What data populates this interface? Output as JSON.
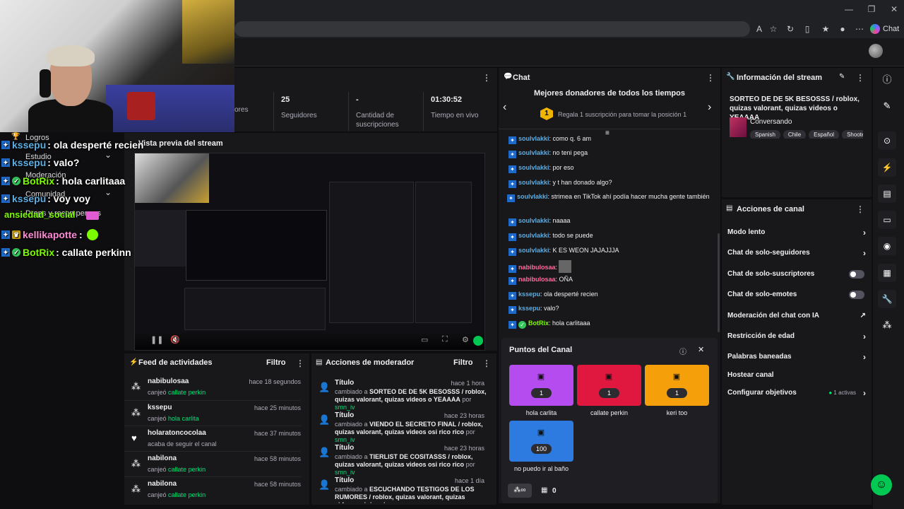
{
  "browser": {
    "chat_label": "Chat"
  },
  "overlay_chat": [
    {
      "user": "kssepu",
      "text": ": ola desperté recien",
      "badge": "blue"
    },
    {
      "user": "kssepu",
      "text": ": valo?",
      "badge": "blue"
    },
    {
      "user": "BotRix",
      "text": ": hola carlitaaa",
      "badge": "blue"
    },
    {
      "user": "kssepu",
      "text": ": voy voy",
      "badge": "blue"
    },
    {
      "user": "kellikapotte",
      "text": ":",
      "badge": "gold"
    },
    {
      "user": "BotRix",
      "text": ": callate perkinn",
      "badge": "blue"
    }
  ],
  "leftnav": {
    "logros": "Logros",
    "estudio": "Estudio",
    "moderacion": "Moderación",
    "comunidad": "Comunidad",
    "social": "ansiedad_social",
    "drops": "Drops y recompensas"
  },
  "stats": [
    {
      "value": "",
      "label": "ores"
    },
    {
      "value": "25",
      "label": "Seguidores"
    },
    {
      "value": "-",
      "label": "Cantidad de suscripciones"
    },
    {
      "value": "01:30:52",
      "label": "Tiempo en vivo"
    }
  ],
  "preview": {
    "title": "Vista previa del stream"
  },
  "feed": {
    "title": "Feed de actividades",
    "filter": "Filtro",
    "items": [
      {
        "name": "nabibulosaa",
        "sub": "canjeó",
        "reward": "callate perkin",
        "time": "hace 18 segundos",
        "icon": "reward-icon"
      },
      {
        "name": "kssepu",
        "sub": "canjeó",
        "reward": "hola carlita",
        "time": "hace 25 minutos",
        "icon": "reward-icon"
      },
      {
        "name": "holaratoncocolaa",
        "sub": "acaba de seguir el canal",
        "reward": "",
        "time": "hace 37 minutos",
        "icon": "heart-icon"
      },
      {
        "name": "nabilona",
        "sub": "canjeó",
        "reward": "callate perkin",
        "time": "hace 58 minutos",
        "icon": "reward-icon"
      },
      {
        "name": "nabilona",
        "sub": "canjeó",
        "reward": "callate perkin",
        "time": "hace 58 minutos",
        "icon": "reward-icon"
      }
    ]
  },
  "modactions": {
    "title": "Acciones de moderador",
    "filter": "Filtro",
    "items": [
      {
        "title": "Título",
        "time": "hace 1 hora",
        "pre": "cambiado a",
        "value": "SORTEO DE DE 5K BESOSSS / roblox, quizas valorant, quizas videos o YEAAAA",
        "by": "por",
        "mod": "smn_iv"
      },
      {
        "title": "Título",
        "time": "hace 23 horas",
        "pre": "cambiado a",
        "value": "VIENDO EL SECRETO FINAL / roblox, quizas valorant, quizas videos osi rico rico",
        "by": "por",
        "mod": "smn_iv"
      },
      {
        "title": "Título",
        "time": "hace 23 horas",
        "pre": "cambiado a",
        "value": "TIERLIST DE COSITASSS / roblox, quizas valorant, quizas videos osi rico rico",
        "by": "por",
        "mod": "smn_iv"
      },
      {
        "title": "Título",
        "time": "hace 1 día",
        "pre": "cambiado a",
        "value": "ESCUCHANDO TESTIGOS DE LOS RUMORES / roblox, quizas valorant, quizas videos osi rico rico",
        "by": "por",
        "mod": ""
      }
    ]
  },
  "chat": {
    "title": "Chat",
    "donors_title": "Mejores donadores de todos los tiempos",
    "donors_rank": "1",
    "donors_text": "Regala 1 suscripción para tomar la posición 1",
    "messages": [
      {
        "user": "soulvlakki",
        "text": ": como q. 6 am",
        "color": "blue"
      },
      {
        "user": "soulvlakki",
        "text": ": no teni pega",
        "color": "blue"
      },
      {
        "user": "soulvlakki",
        "text": ": por eso",
        "color": "blue"
      },
      {
        "user": "soulvlakki",
        "text": ": y t han donado algo?",
        "color": "blue"
      },
      {
        "user": "soulvlakki",
        "text": ": strimea en TikTok ahí podía hacer mucha gente también",
        "color": "blue"
      },
      {
        "user": "soulvlakki",
        "text": ": naaaa",
        "color": "blue"
      },
      {
        "user": "soulvlakki",
        "text": ": todo se puede",
        "color": "blue"
      },
      {
        "user": "soulvlakki",
        "text": ": K ES WEON JAJAJJJA",
        "color": "blue"
      },
      {
        "user": "nabibulosaa",
        "text": ":",
        "color": "pink"
      },
      {
        "user": "nabibulosaa",
        "text": ": OÑA",
        "color": "pink"
      },
      {
        "user": "kssepu",
        "text": ": ola desperté recien",
        "color": "blue"
      },
      {
        "user": "kssepu",
        "text": ": valo?",
        "color": "blue"
      },
      {
        "user": "BotRix",
        "text": ": hola carlitaaa",
        "color": "green"
      }
    ]
  },
  "points": {
    "title": "Puntos del Canal",
    "rewards": [
      {
        "label": "hola carlita",
        "cost": "1",
        "color": "#b44cf0"
      },
      {
        "label": "callate perkin",
        "cost": "1",
        "color": "#e0173f"
      },
      {
        "label": "keri too",
        "cost": "1",
        "color": "#f5a00a"
      },
      {
        "label": "no puedo ir al baño",
        "cost": "100",
        "color": "#2d7be0"
      }
    ],
    "footer_count": "0"
  },
  "streaminfo": {
    "title": "Información del stream",
    "stream_title": "SORTEO DE DE 5K BESOSSS / roblox, quizas valorant, quizas videos o YEAAAA",
    "category": "Conversando",
    "tags": [
      "Spanish",
      "Chile",
      "Español",
      "Shooter"
    ]
  },
  "channelactions": {
    "title": "Acciones de canal",
    "items": [
      {
        "label": "Modo lento",
        "control": "chevron"
      },
      {
        "label": "Chat de solo-seguidores",
        "control": "chevron"
      },
      {
        "label": "Chat de solo-suscriptores",
        "control": "toggle"
      },
      {
        "label": "Chat de solo-emotes",
        "control": "toggle"
      },
      {
        "label": "Moderación del chat con IA",
        "control": "external"
      },
      {
        "label": "Restricción de edad",
        "control": "chevron"
      },
      {
        "label": "Palabras baneadas",
        "control": "chevron"
      },
      {
        "label": "Hostear canal",
        "control": "none"
      },
      {
        "label": "Configurar objetivos",
        "control": "chevron",
        "extra": "1 activas"
      }
    ]
  }
}
